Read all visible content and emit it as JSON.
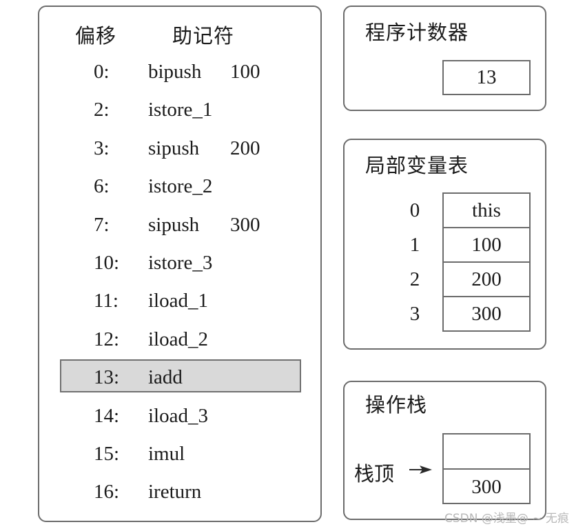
{
  "bytecode": {
    "header_offset": "偏移",
    "header_mnemonic": "助记符",
    "instructions": [
      {
        "offset": "0:",
        "opcode": "bipush",
        "arg": "100",
        "active": false
      },
      {
        "offset": "2:",
        "opcode": "istore_1",
        "arg": "",
        "active": false
      },
      {
        "offset": "3:",
        "opcode": "sipush",
        "arg": "200",
        "active": false
      },
      {
        "offset": "6:",
        "opcode": "istore_2",
        "arg": "",
        "active": false
      },
      {
        "offset": "7:",
        "opcode": "sipush",
        "arg": "300",
        "active": false
      },
      {
        "offset": "10:",
        "opcode": "istore_3",
        "arg": "",
        "active": false
      },
      {
        "offset": "11:",
        "opcode": "iload_1",
        "arg": "",
        "active": false
      },
      {
        "offset": "12:",
        "opcode": "iload_2",
        "arg": "",
        "active": false
      },
      {
        "offset": "13:",
        "opcode": "iadd",
        "arg": "",
        "active": true
      },
      {
        "offset": "14:",
        "opcode": "iload_3",
        "arg": "",
        "active": false
      },
      {
        "offset": "15:",
        "opcode": "imul",
        "arg": "",
        "active": false
      },
      {
        "offset": "16:",
        "opcode": "ireturn",
        "arg": "",
        "active": false
      }
    ],
    "highlight_color": "#d9d9d9"
  },
  "program_counter": {
    "title": "程序计数器",
    "value": "13"
  },
  "local_variable_table": {
    "title": "局部变量表",
    "entries": [
      {
        "index": "0",
        "value": "this"
      },
      {
        "index": "1",
        "value": "100"
      },
      {
        "index": "2",
        "value": "200"
      },
      {
        "index": "3",
        "value": "300"
      }
    ]
  },
  "operand_stack": {
    "title": "操作栈",
    "top_label": "栈顶",
    "arrow_icon": "right-arrow",
    "cells": [
      "",
      "300"
    ]
  },
  "watermark": "CSDN @浅墨@ ~ 无痕"
}
